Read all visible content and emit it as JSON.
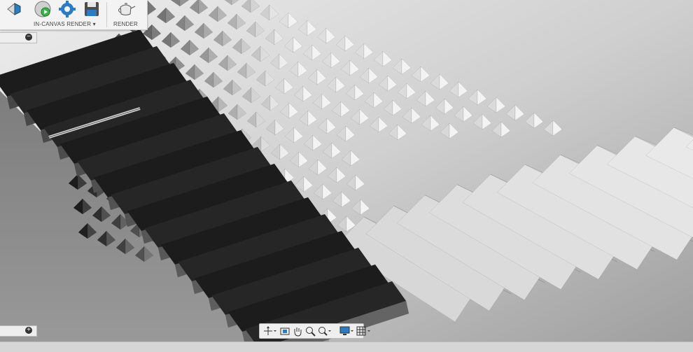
{
  "toolbar": {
    "in_canvas_render_label": "IN-CANVAS RENDER",
    "in_canvas_render_caret": "▾",
    "render_label": "RENDER"
  },
  "browser": {
    "top_toggle": "−",
    "bottom_toggle": "+"
  },
  "colors": {
    "toolbar_bg": "#f3f3f3",
    "accent_blue": "#2d7cc1",
    "green": "#3bb54a"
  }
}
